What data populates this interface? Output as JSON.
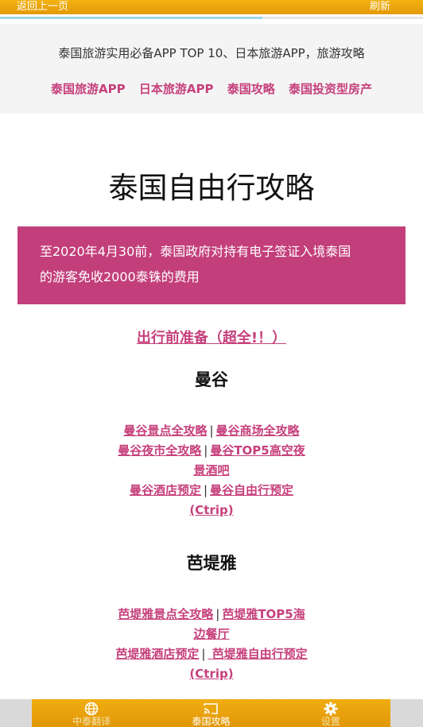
{
  "topbar": {
    "back_label": "返回上一页",
    "refresh_label": "刷新",
    "progress": 0.62
  },
  "header": {
    "title": "泰国旅游实用必备APP TOP 10、日本旅游APP，旅游攻略",
    "links": [
      "泰国旅游APP",
      "日本旅游APP",
      "泰国攻略",
      "泰国投资型房产"
    ]
  },
  "main": {
    "title": "泰国自由行攻略",
    "notice_line1": "至2020年4月30前，泰国政府对持有电子签证入境泰国",
    "notice_line2": "的游客免收2000泰铢的费用",
    "prep_link": "出行前准备（超全!！）",
    "bangkok": {
      "title": "曼谷",
      "link1": "曼谷景点全攻略",
      "link2": "曼谷商场全攻略",
      "link3": "曼谷夜市全攻略",
      "link4a": "曼谷TOP5高空夜",
      "link4b": "景酒吧",
      "link5": "曼谷酒店预定",
      "link6a": "曼谷自由行预定",
      "link6b": "(Ctrip)",
      "separator": "|"
    },
    "pattaya": {
      "title": "芭堤雅",
      "link1": "芭堤雅景点全攻略",
      "link2a": "芭堤雅TOP5海",
      "link2b": "边餐厅",
      "link3": "芭堤雅酒店预定",
      "link4a": " 芭堤雅自由行预定",
      "link4b": "(Ctrip)",
      "separator": "|"
    }
  },
  "bottom_nav": {
    "items": [
      {
        "label": "中泰翻译",
        "icon": "globe-icon"
      },
      {
        "label": "泰国攻略",
        "icon": "cast-icon"
      },
      {
        "label": "设置",
        "icon": "gear-icon"
      }
    ]
  },
  "colors": {
    "accent_orange": "#e8a20c",
    "brand_pink": "#c33f7b"
  }
}
